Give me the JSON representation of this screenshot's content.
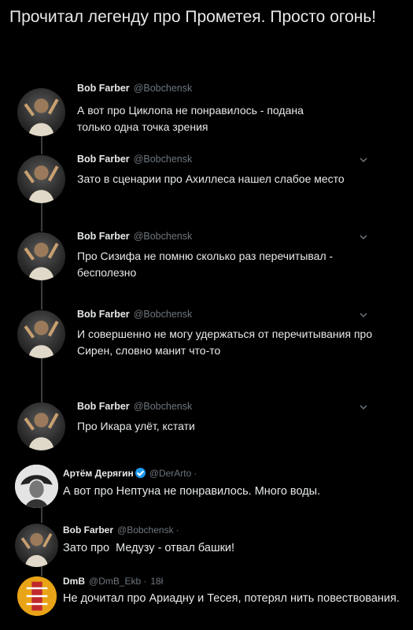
{
  "caption": "Прочитал легенду про Прометея. Просто огонь!",
  "colors": {
    "background": "#000000",
    "text": "#e7e9ea",
    "muted": "#6e767d",
    "verified": "#1d9bf0"
  },
  "thread": [
    {
      "name": "Bob Farber",
      "handle": "@Bobchensk",
      "text": "А вот про Циклопа не понравилось - подана только одна точка зрения",
      "avatar": "bob-farber-avatar"
    },
    {
      "name": "Bob Farber",
      "handle": "@Bobchensk",
      "text": "Зато в сценарии про Ахиллеса нашел слабое место",
      "avatar": "bob-farber-avatar"
    },
    {
      "name": "Bob Farber",
      "handle": "@Bobchensk",
      "text": "Про Сизифа не помню сколько раз перечитывал - бесполезно",
      "avatar": "bob-farber-avatar"
    },
    {
      "name": "Bob Farber",
      "handle": "@Bobchensk",
      "text": "И совершенно не могу удержаться от перечитывания про Сирен, словно манит что-то",
      "avatar": "bob-farber-avatar"
    },
    {
      "name": "Bob Farber",
      "handle": "@Bobchensk",
      "text": "Про Икара улёт, кстати",
      "avatar": "bob-farber-avatar"
    }
  ],
  "replies": [
    {
      "name": "Артём Дерягин",
      "handle": "@DerArto",
      "dot": "·",
      "time": "",
      "text": "А вот про Нептуна не понравилось. Много воды.",
      "avatar": "artem-avatar"
    },
    {
      "name": "Bob Farber",
      "handle": "@Bobchensk",
      "dot": "·",
      "time": "",
      "text": "Зато про  Медузу - отвал башки!",
      "avatar": "bob-farber-avatar"
    },
    {
      "name": "DmB",
      "handle": "@DmB_Ekb",
      "dot": "·",
      "time": "18ł",
      "text": "Не дочитал про Ариадну и Тесея, потерял нить повествования.",
      "avatar": "dmb-avatar"
    }
  ]
}
